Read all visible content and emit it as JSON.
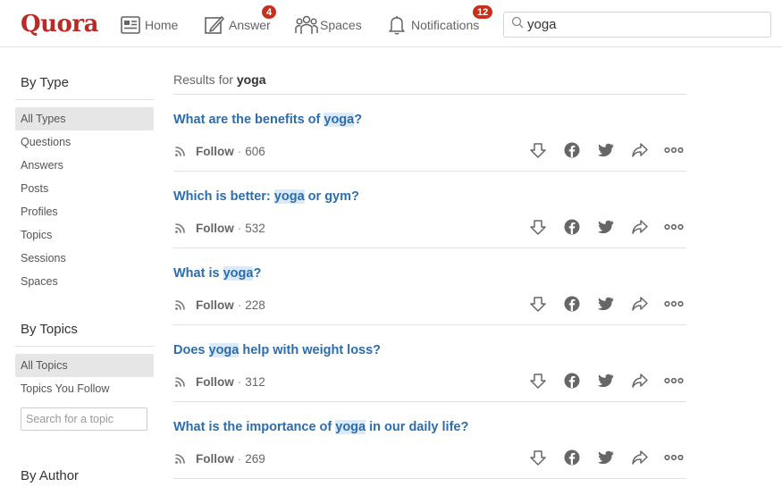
{
  "brand": {
    "logo_text": "Quora",
    "color": "#b92b27"
  },
  "nav": {
    "home_label": "Home",
    "answer_label": "Answer",
    "answer_badge": "4",
    "spaces_label": "Spaces",
    "notifications_label": "Notifications",
    "notifications_badge": "12"
  },
  "search": {
    "value": "yoga"
  },
  "sidebar": {
    "by_type": {
      "heading": "By Type",
      "items": [
        "All Types",
        "Questions",
        "Answers",
        "Posts",
        "Profiles",
        "Topics",
        "Sessions",
        "Spaces"
      ],
      "selected": "All Types"
    },
    "by_topics": {
      "heading": "By Topics",
      "items": [
        "All Topics",
        "Topics You Follow"
      ],
      "selected": "All Topics",
      "search_placeholder": "Search for a topic"
    },
    "by_author": {
      "heading": "By Author"
    }
  },
  "results": {
    "prefix": "Results for",
    "query": "yoga",
    "follow_label": "Follow",
    "items": [
      {
        "before": "What are the benefits of ",
        "highlight": "yoga",
        "after": "?",
        "follow_count": "606"
      },
      {
        "before": "Which is better: ",
        "highlight": "yoga",
        "after": " or gym?",
        "follow_count": "532"
      },
      {
        "before": "What is ",
        "highlight": "yoga",
        "after": "?",
        "follow_count": "228"
      },
      {
        "before": "Does ",
        "highlight": "yoga",
        "after": " help with weight loss?",
        "follow_count": "312"
      },
      {
        "before": "What is the importance of ",
        "highlight": "yoga",
        "after": " in our daily life?",
        "follow_count": "269"
      }
    ],
    "action_icons": [
      "downvote-icon",
      "facebook-icon",
      "twitter-icon",
      "share-icon",
      "more-icon"
    ]
  }
}
